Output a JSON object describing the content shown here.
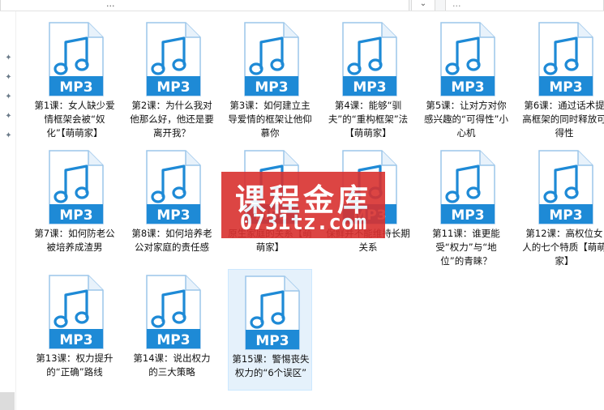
{
  "window": {
    "path_text": "...",
    "search_placeholder": "...",
    "dropdown_label": "⌄"
  },
  "icon_badge": "MP3",
  "files": [
    {
      "label": "第1课：女人缺少爱情框架会被“奴化”【萌萌家】"
    },
    {
      "label": "第2课：为什么我对他那么好，他还是要离开我？"
    },
    {
      "label": "第3课：如何建立主导爱情的框架让他仰慕你"
    },
    {
      "label": "第4课：能够“驯夫”的“重构框架”法【萌萌家】"
    },
    {
      "label": "第5课：让对方对你感兴趣的“可得性”小心机"
    },
    {
      "label": "第6课：通过话术提高框架的同时释放可得性"
    },
    {
      "label": "第7课：如何防老公被培养成渣男"
    },
    {
      "label": "第8课：如何培养老公对家庭的责任感"
    },
    {
      "label": "原生家庭的关系【萌萌家】"
    },
    {
      "label": "保鲜并不能维持长期关系"
    },
    {
      "label": "第11课：谁更能受“权力”与“地位”的青睐？"
    },
    {
      "label": "第12课：高权位女人的七个特质【萌萌家】"
    },
    {
      "label": "第13课：权力提升的“正确”路线"
    },
    {
      "label": "第14课：说出权力的三大策略"
    },
    {
      "label": "第15课：警惕丧失权力的“6个误区”"
    }
  ],
  "watermark": {
    "line1": "课程金库",
    "line2": "0731tz.com"
  },
  "colors": {
    "icon_blue": "#1e8ad6",
    "icon_page": "#ffffff",
    "selection": "#e5f1fb",
    "watermark": "#d9312f"
  }
}
